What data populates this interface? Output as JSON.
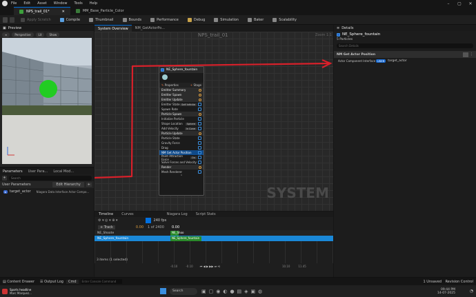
{
  "menu": [
    "File",
    "Edit",
    "Asset",
    "Window",
    "Tools",
    "Help"
  ],
  "tabs": [
    {
      "label": "NPS_trail_01*",
      "active": true
    },
    {
      "label": "MM_Base_Particle_Color",
      "active": false
    }
  ],
  "toolbar": {
    "apply_scratch": "Apply Scratch",
    "compile": "Compile",
    "thumbnail": "Thumbnail",
    "bounds": "Bounds",
    "performance": "Performance",
    "debug": "Debug",
    "simulation": "Simulation",
    "baker": "Baker",
    "scalability": "Scalability"
  },
  "preview": {
    "title": "Preview",
    "perspective": "Perspective",
    "lit": "Lit",
    "show": "Show"
  },
  "params_tabs": [
    "Parameters",
    "User Para...",
    "Local Mod..."
  ],
  "params": {
    "search_placeholder": "Search",
    "user_params": "User Parameters",
    "edit_hierarchy": "Edit Hierarchy",
    "actor_name": "target_actor",
    "actor_type": "Niagara Data Interface Actor Compo..."
  },
  "center_tabs": [
    "System Overview",
    "NM_GetActorPo..."
  ],
  "graph": {
    "title": "NPS_trail_01",
    "zoom": "Zoom 1:1",
    "watermark": "SYSTEM"
  },
  "node": {
    "name": "NE_Sphere_fountain",
    "properties": "Properties",
    "stage": "Stage",
    "rows": [
      {
        "label": "Emitter Summary",
        "section": true
      },
      {
        "label": "Emitter Spawn",
        "section": true
      },
      {
        "label": "Emitter Update",
        "section": true
      },
      {
        "label": "Emitter State",
        "value": "Self   Infinite",
        "section": false
      },
      {
        "label": "Spawn Rate",
        "section": false
      },
      {
        "label": "Particle Spawn",
        "section": true
      },
      {
        "label": "Initialize Particle",
        "section": false
      },
      {
        "label": "Shape Location",
        "value": "Sphere",
        "section": false
      },
      {
        "label": "Add Velocity",
        "value": "In Cone",
        "section": false
      },
      {
        "label": "Particle Update",
        "section": true
      },
      {
        "label": "Particle State",
        "section": false
      },
      {
        "label": "Gravity Force",
        "section": false
      },
      {
        "label": "Drag",
        "section": false
      },
      {
        "label": "NM Get Actor Position",
        "section": false,
        "selected": true
      },
      {
        "label": "Point Attraction Force",
        "value": "On",
        "section": false
      },
      {
        "label": "Solve Forces and Velocity",
        "section": false
      },
      {
        "label": "Render",
        "section": true
      },
      {
        "label": "Mesh Renderer",
        "section": false
      }
    ]
  },
  "details": {
    "title": "Details",
    "emitter_name": "NE_Sphere_fountain",
    "particles": "5 Particles",
    "search_placeholder": "Search Details",
    "module": "NM Get Actor Position",
    "prop_label": "Actor Component Interface",
    "prop_badge": "USER",
    "prop_value": "target_actor"
  },
  "timeline": {
    "tabs": [
      "Timeline",
      "Curves",
      "Niagara Log",
      "Script Stats"
    ],
    "fps": "240 fps",
    "track": "+ Track",
    "time_start": "0.00",
    "frames": "1 of 2400",
    "time_cursor": "0.00",
    "tracks": [
      "NE_Shoote",
      "NE_Sphere_fountain"
    ],
    "clip_labels": [
      "NE_Shoo",
      "NE_Sphere_fountain"
    ],
    "items": "3 items (1 selected)",
    "t_left1": "-0.10",
    "t_left2": "-0.10",
    "t_right1": "10.10",
    "t_right2": "11.45"
  },
  "statusbar": {
    "content_drawer": "Content Drawer",
    "output_log": "Output Log",
    "cmd": "Cmd",
    "cmd_placeholder": "Enter Console Command",
    "unsaved": "1 Unsaved",
    "revision": "Revision Control"
  },
  "taskbar": {
    "news_title": "Sports headline",
    "news_sub": "Marc Marquez...",
    "search": "Search",
    "time": "09:44 PM",
    "date": "14-07-2025"
  },
  "colors": {
    "accent": "#0070e0",
    "annotation": "#d8202a",
    "green_ball": "#22cc22",
    "selected_track": "#1a88d8",
    "clip_green": "#2a8a2a"
  }
}
